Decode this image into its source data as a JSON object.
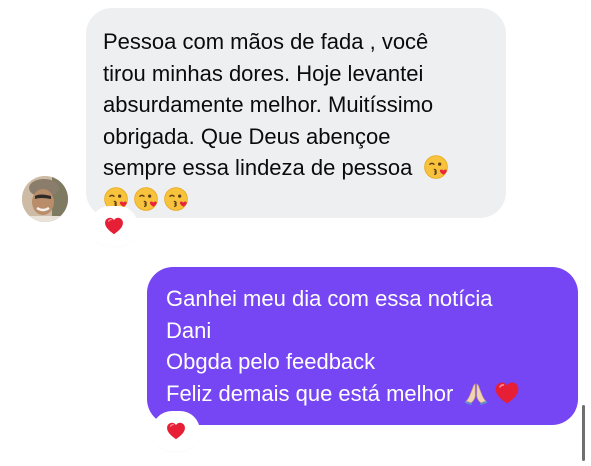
{
  "incoming_message": {
    "lines": [
      "Pessoa com mãos de fada , você",
      "tirou minhas dores. Hoje levantei",
      "absurdamente melhor. Muitíssimo",
      "obrigada. Que Deus abençoe",
      "sempre essa lindeza de pessoa"
    ],
    "emojis": [
      "face-blowing-kiss",
      "face-blowing-kiss",
      "face-blowing-kiss",
      "face-blowing-kiss"
    ],
    "bubble_color": "#eeeff1",
    "reaction": "red-heart"
  },
  "outgoing_message": {
    "lines": [
      "Ganhei meu dia com essa notícia",
      "Dani",
      "Obgda pelo feedback",
      "Feliz demais que está melhor"
    ],
    "emojis": [
      "folded-hands",
      "red-heart"
    ],
    "bubble_color": "#7645f4",
    "reaction": "red-heart"
  }
}
